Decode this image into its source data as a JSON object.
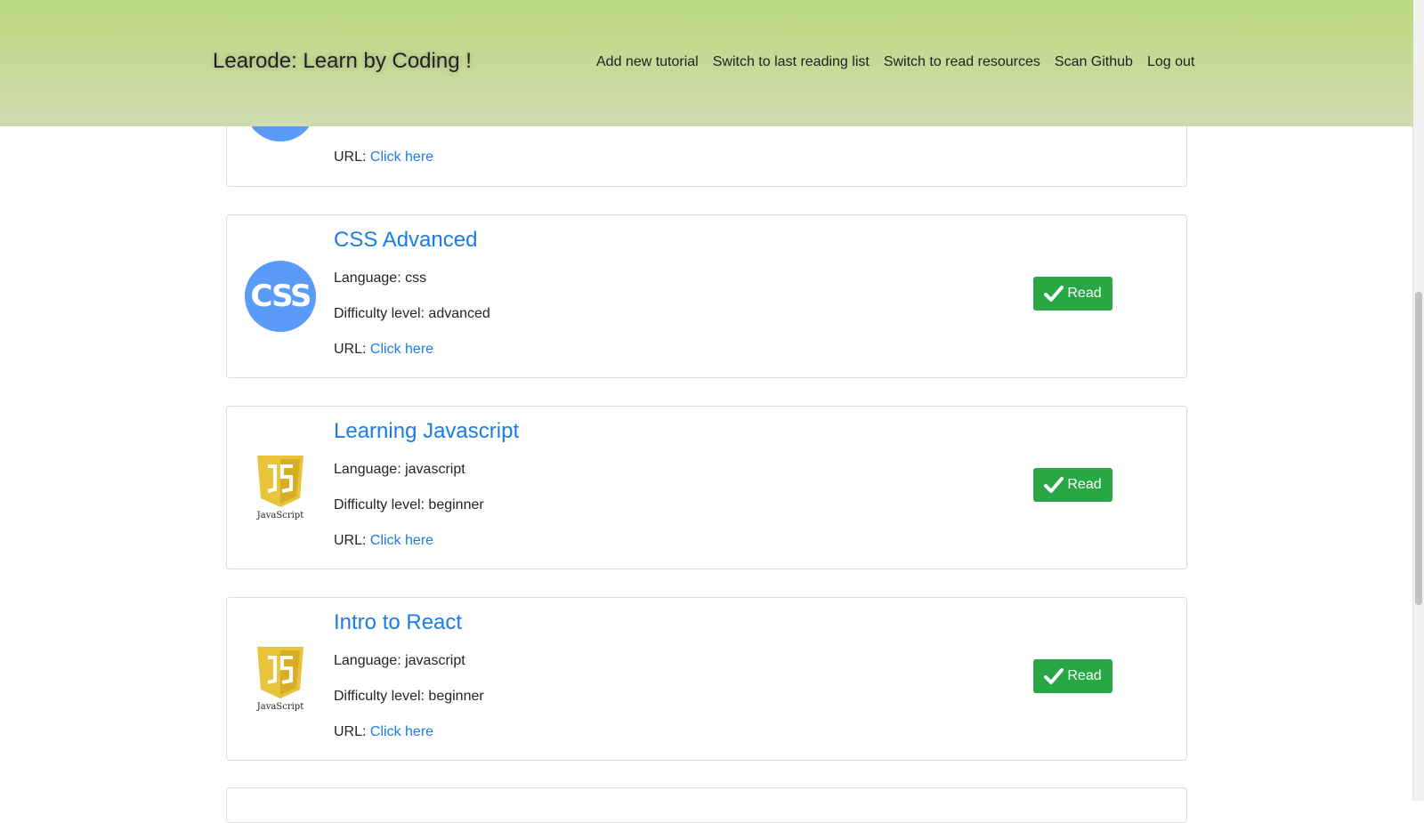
{
  "navbar": {
    "brand": "Learode: Learn by Coding !",
    "links": [
      "Add new tutorial",
      "Switch to last reading list",
      "Switch to read resources",
      "Scan Github",
      "Log out"
    ]
  },
  "labels": {
    "language": "Language:",
    "difficulty": "Difficulty level:",
    "url": "URL:",
    "url_link": "Click here",
    "read_button": "Read"
  },
  "tutorials": [
    {
      "title": "",
      "language": "",
      "difficulty": "",
      "logo": "css-logo"
    },
    {
      "title": "CSS Advanced",
      "language": "css",
      "difficulty": "advanced",
      "logo": "css-logo",
      "logo_text": "CSS"
    },
    {
      "title": "Learning Javascript",
      "language": "javascript",
      "difficulty": "beginner",
      "logo": "javascript-logo",
      "logo_text": "JavaScript"
    },
    {
      "title": "Intro to React",
      "language": "javascript",
      "difficulty": "beginner",
      "logo": "javascript-logo",
      "logo_text": "JavaScript"
    }
  ],
  "colors": {
    "navbar": "#bcd97e",
    "link": "#1a7ce8",
    "read_button": "#28a745",
    "css_logo": "#5b9bf8",
    "js_logo": "#e8c43a"
  }
}
